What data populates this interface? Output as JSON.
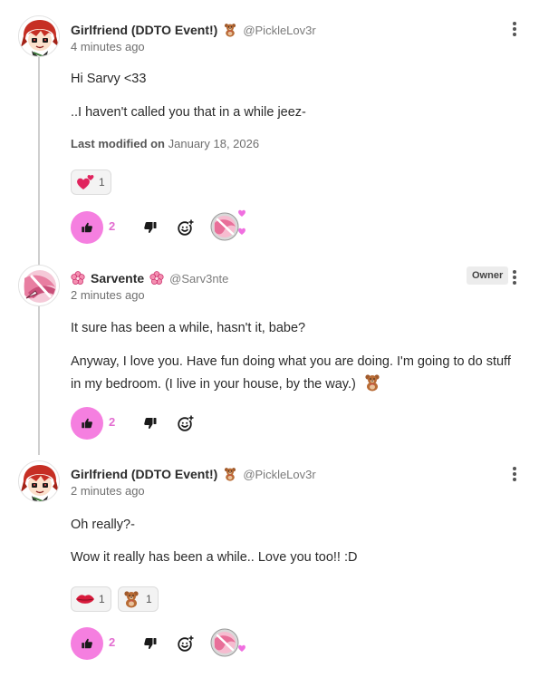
{
  "comments": [
    {
      "username": "Girlfriend (DDTO Event!)",
      "badge_icon": "teddy-bear-icon",
      "handle": "@PickleLov3r",
      "timestamp": "4 minutes ago",
      "paragraphs": [
        "Hi Sarvy <33",
        "..I haven't called you that in a while jeez-"
      ],
      "modified_label": "Last modified on",
      "modified_date": "January 18, 2026",
      "reactions": [
        {
          "icon": "two-hearts-icon",
          "count": "1"
        }
      ],
      "like_count": "2"
    },
    {
      "username": "Sarvente",
      "badge_icon": "pink-flower-icon",
      "handle": "@Sarv3nte",
      "owner_label": "Owner",
      "timestamp": "2 minutes ago",
      "paragraphs": [
        "It sure has been a while, hasn't it, babe?",
        "Anyway, I love you. Have fun doing what you are doing. I'm going to do stuff in my bedroom. (I live in your house, by the way.)"
      ],
      "inline_emoji": "teddy-bear-icon",
      "like_count": "2"
    },
    {
      "username": "Girlfriend (DDTO Event!)",
      "badge_icon": "teddy-bear-icon",
      "handle": "@PickleLov3r",
      "timestamp": "2 minutes ago",
      "paragraphs": [
        "Oh really?-",
        "Wow it really has been a while.. Love you too!! :D"
      ],
      "reactions": [
        {
          "icon": "lips-icon",
          "count": "1"
        },
        {
          "icon": "teddy-bear-icon",
          "count": "1"
        }
      ],
      "like_count": "2"
    }
  ],
  "colors": {
    "accent_pink": "#f57fe0",
    "like_count": "#e36cd0",
    "thread_line": "#cfcfcf"
  }
}
